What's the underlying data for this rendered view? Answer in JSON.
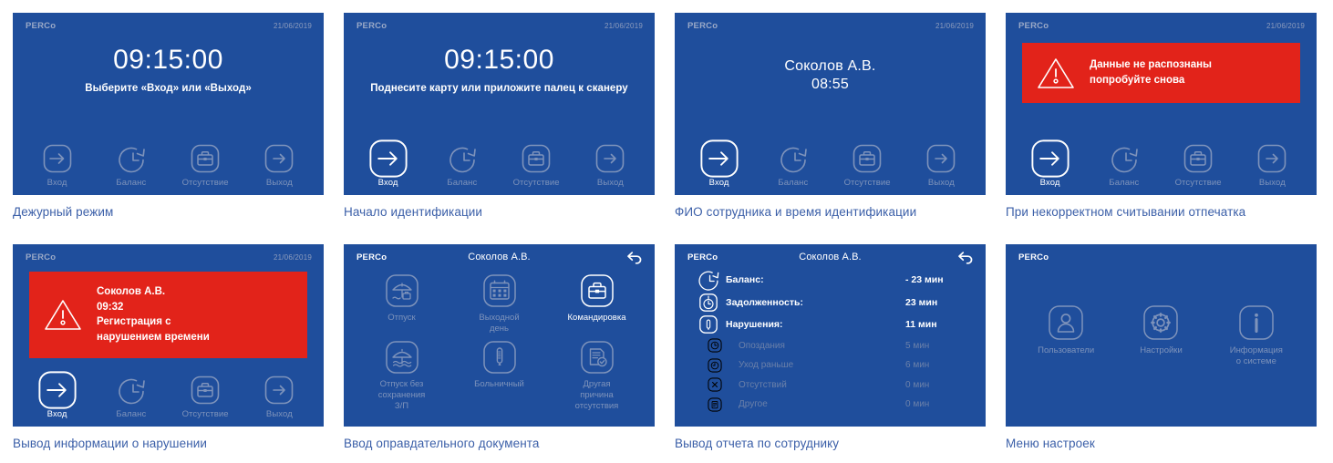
{
  "brand": "PERCo",
  "date": "21/06/2019",
  "colors": {
    "screen_bg": "#1f4e9c",
    "alert_red": "#e2231a",
    "caption_blue": "#3b5fa8",
    "dim_text": "#7e93bb"
  },
  "nav": {
    "items": [
      {
        "label": "Вход",
        "icon": "enter-arrow-icon"
      },
      {
        "label": "Баланс",
        "icon": "clock-rewind-icon"
      },
      {
        "label": "Отсутствие",
        "icon": "briefcase-icon"
      },
      {
        "label": "Выход",
        "icon": "exit-arrow-icon"
      }
    ]
  },
  "panels": [
    {
      "id": "standby",
      "caption": "Дежурный режим",
      "clock": "09:15:00",
      "hint": "Выберите «Вход» или «Выход»",
      "active_nav": -1
    },
    {
      "id": "identification-start",
      "caption": "Начало идентификации",
      "clock": "09:15:00",
      "hint": "Поднесите карту или приложите палец к сканеру",
      "active_nav": 0
    },
    {
      "id": "employee-identified",
      "caption": "ФИО сотрудника и время идентификации",
      "person_name": "Соколов А.В.",
      "person_time": "08:55",
      "active_nav": 0
    },
    {
      "id": "read-error",
      "caption": "При некорректном считывании отпечатка",
      "alert_lines": [
        "Данные не распознаны",
        "попробуйте снова"
      ],
      "active_nav": 0
    },
    {
      "id": "violation-info",
      "caption": "Вывод информации о нарушении",
      "alert_lines": [
        "Соколов А.В.",
        "09:32",
        "Регистрация с",
        "нарушением времени"
      ],
      "active_nav": 0
    },
    {
      "id": "absence-document",
      "caption": "Ввод оправдательного документа",
      "header_title": "Соколов А.В.",
      "tiles": [
        {
          "label": "Отпуск",
          "icon": "beach-umbrella-bag-icon",
          "bright": false
        },
        {
          "label": "Выходной\nдень",
          "icon": "calendar-icon",
          "bright": false
        },
        {
          "label": "Командировка",
          "icon": "briefcase-icon",
          "bright": true
        },
        {
          "label": "Отпуск без\nсохранения\nЗ/П",
          "icon": "beach-umbrella-waves-icon",
          "bright": false
        },
        {
          "label": "Больничный",
          "icon": "thermometer-icon",
          "bright": false
        },
        {
          "label": "Другая\nпричина\nотсутствия",
          "icon": "document-check-icon",
          "bright": false
        }
      ]
    },
    {
      "id": "employee-report",
      "caption": "Вывод отчета по сотруднику",
      "header_title": "Соколов А.В.",
      "rows": [
        {
          "icon": "clock-rewind-icon",
          "label": "Баланс:",
          "value": "- 23 мин",
          "sub": false
        },
        {
          "icon": "clock-down-icon",
          "label": "Задолженность:",
          "value": "23 мин",
          "sub": false
        },
        {
          "icon": "thermometer-icon",
          "label": "Нарушения:",
          "value": "11 мин",
          "sub": false
        },
        {
          "icon": "clock-late-icon",
          "label": "Опоздания",
          "value": "5 мин",
          "sub": true
        },
        {
          "icon": "clock-early-icon",
          "label": "Уход раньше",
          "value": "6 мин",
          "sub": true
        },
        {
          "icon": "cross-icon",
          "label": "Отсутствий",
          "value": "0 мин",
          "sub": true
        },
        {
          "icon": "document-icon",
          "label": "Другое",
          "value": "0 мин",
          "sub": true
        }
      ]
    },
    {
      "id": "settings-menu",
      "caption": "Меню настроек",
      "tiles": [
        {
          "label": "Пользователи",
          "icon": "user-icon"
        },
        {
          "label": "Настройки",
          "icon": "gear-icon"
        },
        {
          "label": "Информация\nо системе",
          "icon": "info-icon"
        }
      ]
    }
  ]
}
